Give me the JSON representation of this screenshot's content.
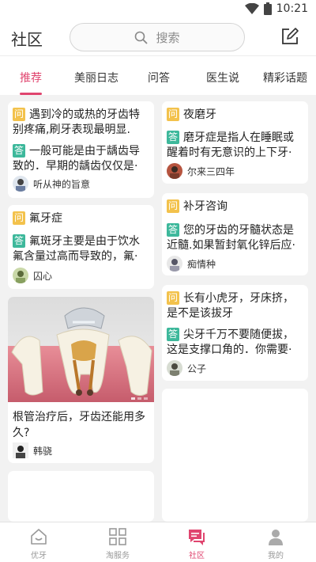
{
  "status_bar": {
    "time": "10:21"
  },
  "header": {
    "title": "社区",
    "search_placeholder": "搜索"
  },
  "tabs": [
    {
      "label": "推荐",
      "active": true
    },
    {
      "label": "美丽日志",
      "active": false
    },
    {
      "label": "问答",
      "active": false
    },
    {
      "label": "医生说",
      "active": false
    },
    {
      "label": "精彩话题",
      "active": false
    }
  ],
  "cards": [
    {
      "question": "遇到冷的或热的牙齿特别疼痛,刷牙表现最明显.",
      "answer": "一般可能是由于龋齿导致的．早期的龋齿仅仅是·",
      "user": "听从神的旨意"
    },
    {
      "question": "夜磨牙",
      "answer": "磨牙症是指人在睡眠或醒着时有无意识的上下牙·",
      "user": "尔来三四年"
    },
    {
      "question": "氟牙症",
      "answer": "氟斑牙主要是由于饮水氟含量过高而导致的，氟·",
      "user": "囚心"
    },
    {
      "question": "补牙咨询",
      "answer": "您的牙齿的牙髓状态是近髓.如果暂封氧化锌后应·",
      "user": "痴情种"
    },
    {
      "question": "长有小虎牙，牙床挤，是不是该拔牙",
      "answer": "尖牙千万不要随便拔，这是支撑口角的．你需要·",
      "user": "公子"
    }
  ],
  "article": {
    "title": "根管治疗后，牙齿还能用多久?",
    "author": "韩骁"
  },
  "bottom_nav": [
    {
      "label": "优牙",
      "icon": "home-icon",
      "active": false
    },
    {
      "label": "淘服务",
      "icon": "grid-icon",
      "active": false
    },
    {
      "label": "社区",
      "icon": "chat-icon",
      "active": true
    },
    {
      "label": "我的",
      "icon": "person-icon",
      "active": false
    }
  ],
  "labels": {
    "question_tag": "问",
    "answer_tag": "答"
  },
  "colors": {
    "accent": "#e0456f",
    "question_tag": "#f3c24c",
    "answer_tag": "#3db89b"
  }
}
